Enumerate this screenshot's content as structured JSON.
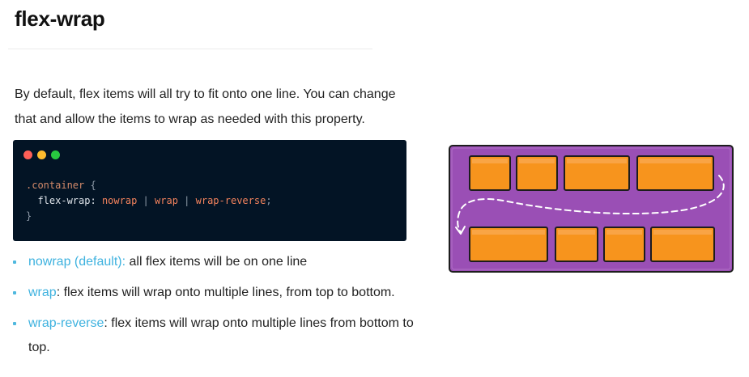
{
  "heading": "flex-wrap",
  "intro": "By default, flex items will all try to fit onto one line. You can change that and allow the items to wrap as needed with this property.",
  "code": {
    "selector": ".container",
    "open_brace": "{",
    "property": "flex-wrap",
    "colon": ":",
    "values": [
      "nowrap",
      "wrap",
      "wrap-reverse"
    ],
    "separator": "|",
    "semicolon": ";",
    "close_brace": "}",
    "dot_colors": [
      "#ff5f57",
      "#febc2e",
      "#28c840"
    ]
  },
  "bullets": [
    {
      "keyword": "nowrap (default):",
      "text": " all flex items will be on one line"
    },
    {
      "keyword": "wrap",
      "text": ": flex items will wrap onto multiple lines, from top to bottom."
    },
    {
      "keyword": "wrap-reverse",
      "text": ": flex items will wrap onto multiple lines from bottom to top."
    }
  ],
  "colors": {
    "accent": "#3eb2df",
    "container_purple": "#9a4fb5",
    "item_orange": "#f7941d",
    "code_bg": "#031425"
  }
}
